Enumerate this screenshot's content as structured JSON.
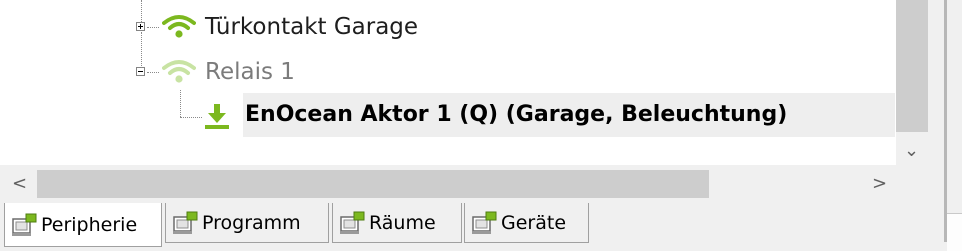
{
  "tree": {
    "nodes": [
      {
        "label": "Türkontakt Garage",
        "icon": "wifi-signal-icon",
        "state": "collapsed"
      },
      {
        "label": "Relais 1",
        "icon": "wifi-signal-icon",
        "state": "expanded"
      },
      {
        "label": "EnOcean Aktor 1 (Q) (Garage, Beleuchtung)",
        "icon": "download-arrow-icon",
        "selected": true
      }
    ]
  },
  "scrollbars": {
    "left_arrow": "<",
    "right_arrow": ">",
    "down_arrow": "⌄"
  },
  "tabs": [
    {
      "label": "Peripherie",
      "active": true
    },
    {
      "label": "Programm",
      "active": false
    },
    {
      "label": "Räume",
      "active": false
    },
    {
      "label": "Geräte",
      "active": false
    }
  ],
  "colors": {
    "signal_green": "#7cb81f",
    "signal_faded": "#c8e3a3",
    "selection": "#eeeeee",
    "scroll_thumb": "#cdcdcd"
  }
}
